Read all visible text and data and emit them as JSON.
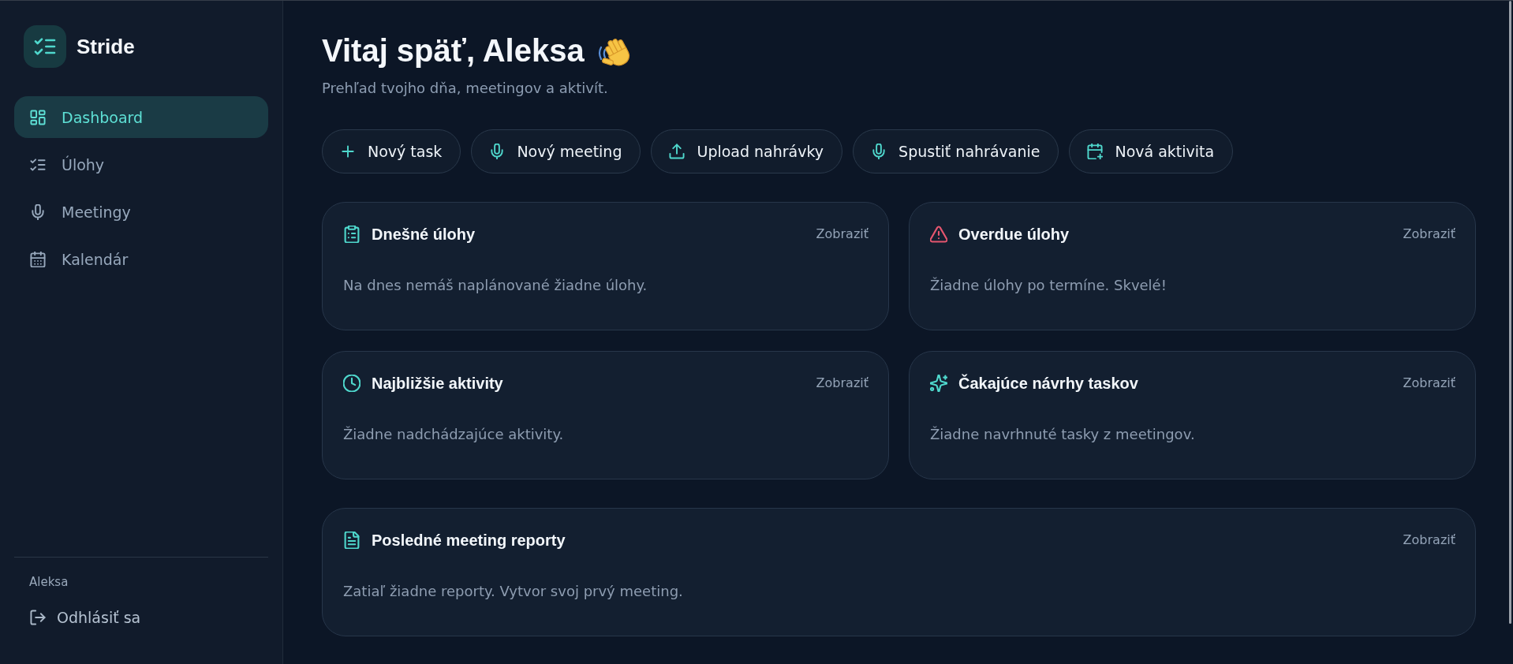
{
  "sidebar": {
    "brand": "Stride",
    "nav": [
      {
        "kind": "dashboard",
        "label": "Dashboard",
        "selected": true
      },
      {
        "kind": "tasks",
        "label": "Úlohy",
        "selected": false
      },
      {
        "kind": "meetings",
        "label": "Meetingy",
        "selected": false
      },
      {
        "kind": "calendar",
        "label": "Kalendár",
        "selected": false
      }
    ],
    "user": "Aleksa",
    "logout": "Odhlásiť sa"
  },
  "header": {
    "title": "Vitaj späť, Aleksa",
    "subtitle": "Prehľad tvojho dňa, meetingov a aktivít."
  },
  "quick_actions": [
    {
      "kind": "task",
      "label": "Nový task"
    },
    {
      "kind": "meeting",
      "label": "Nový meeting"
    },
    {
      "kind": "upload",
      "label": "Upload nahrávky"
    },
    {
      "kind": "record",
      "label": "Spustiť nahrávanie"
    },
    {
      "kind": "activity",
      "label": "Nová aktivita"
    }
  ],
  "cards": [
    {
      "kind": "today",
      "title": "Dnešné úlohy",
      "link": "Zobraziť",
      "empty_text": "Na dnes nemáš naplánované žiadne úlohy."
    },
    {
      "kind": "overdue",
      "title": "Overdue úlohy",
      "link": "Zobraziť",
      "empty_text": "Žiadne úlohy po termíne. Skvelé!"
    },
    {
      "kind": "activities",
      "title": "Najbližšie aktivity",
      "link": "Zobraziť",
      "empty_text": "Žiadne nadchádzajúce aktivity."
    },
    {
      "kind": "suggestions",
      "title": "Čakajúce návrhy taskov",
      "link": "Zobraziť",
      "empty_text": "Žiadne navrhnuté tasky z meetingov."
    }
  ],
  "reports": {
    "title": "Posledné meeting reporty",
    "link": "Zobraziť",
    "empty_text": "Zatiaľ žiadne reporty. Vytvor svoj prvý meeting."
  }
}
